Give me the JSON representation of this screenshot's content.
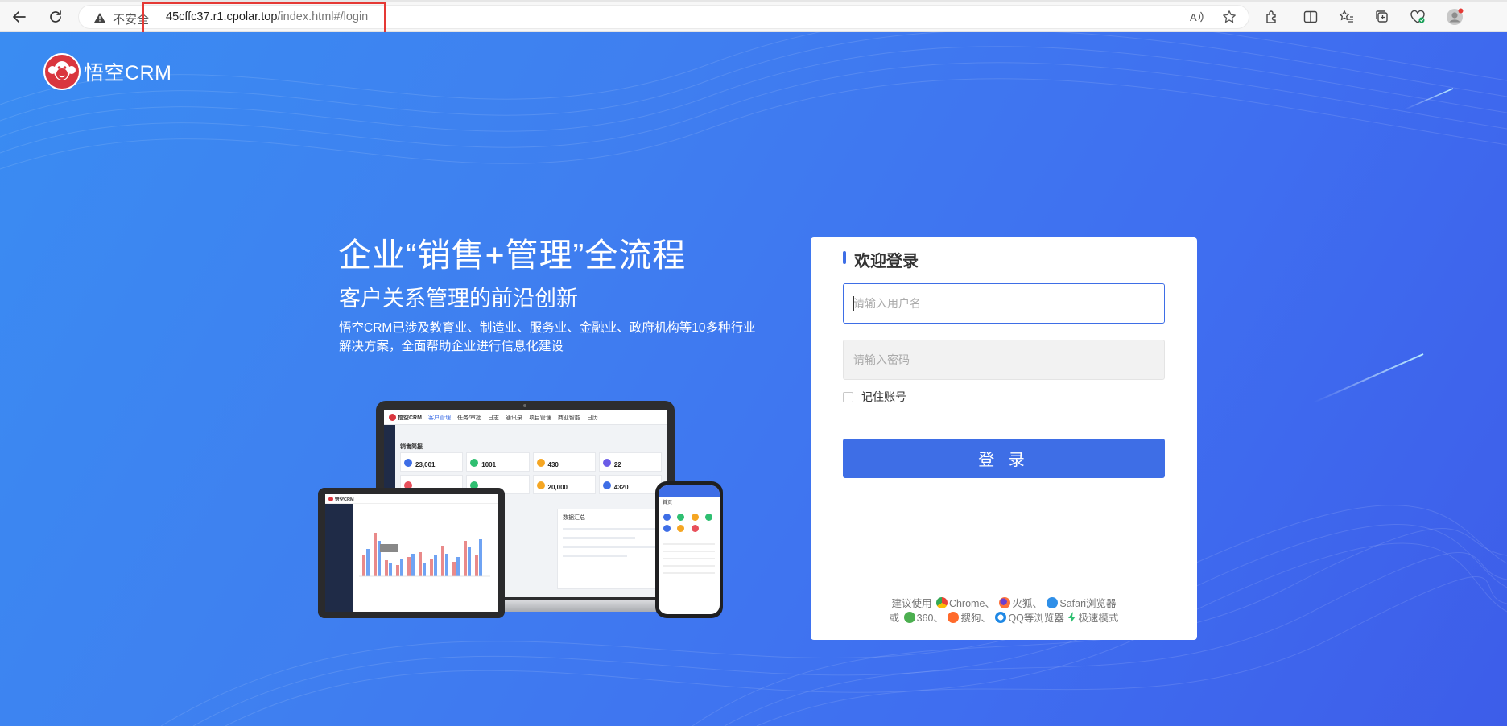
{
  "browser": {
    "security_label": "不安全",
    "url_host": "45cffc37.r1.cpolar.top",
    "url_path": "/index.html#/login"
  },
  "brand": {
    "name": "悟空CRM"
  },
  "hero": {
    "title": "企业“销售+管理”全流程",
    "subtitle": "客户关系管理的前沿创新",
    "description": "悟空CRM已涉及教育业、制造业、服务业、金融业、政府机构等10多种行业解决方案，全面帮助企业进行信息化建设"
  },
  "illustration": {
    "laptop_logo": "悟空CRM",
    "laptop_tabs": [
      "客户管理",
      "任务/审批",
      "日志",
      "通讯录",
      "项目管理",
      "商业智能",
      "日历"
    ],
    "laptop_section": "销售简报",
    "laptop_stats": [
      "23,001",
      "1001",
      "430",
      "22",
      "20,000",
      "4320"
    ],
    "laptop_summary_title": "数据汇总",
    "tablet_logo": "悟空CRM",
    "phone_title": "首页"
  },
  "login": {
    "title": "欢迎登录",
    "username_placeholder": "请输入用户名",
    "password_placeholder": "请输入密码",
    "remember_label": "记住账号",
    "submit_label": "登 录",
    "tips_line1_prefix": "建议使用",
    "tips_chrome": "Chrome、",
    "tips_firefox": "火狐、",
    "tips_safari": "Safari浏览器",
    "tips_line2_prefix": "或",
    "tips_360": "360、",
    "tips_sogou": "搜狗、",
    "tips_qq": "QQ等浏览器",
    "tips_fast": "极速模式"
  }
}
